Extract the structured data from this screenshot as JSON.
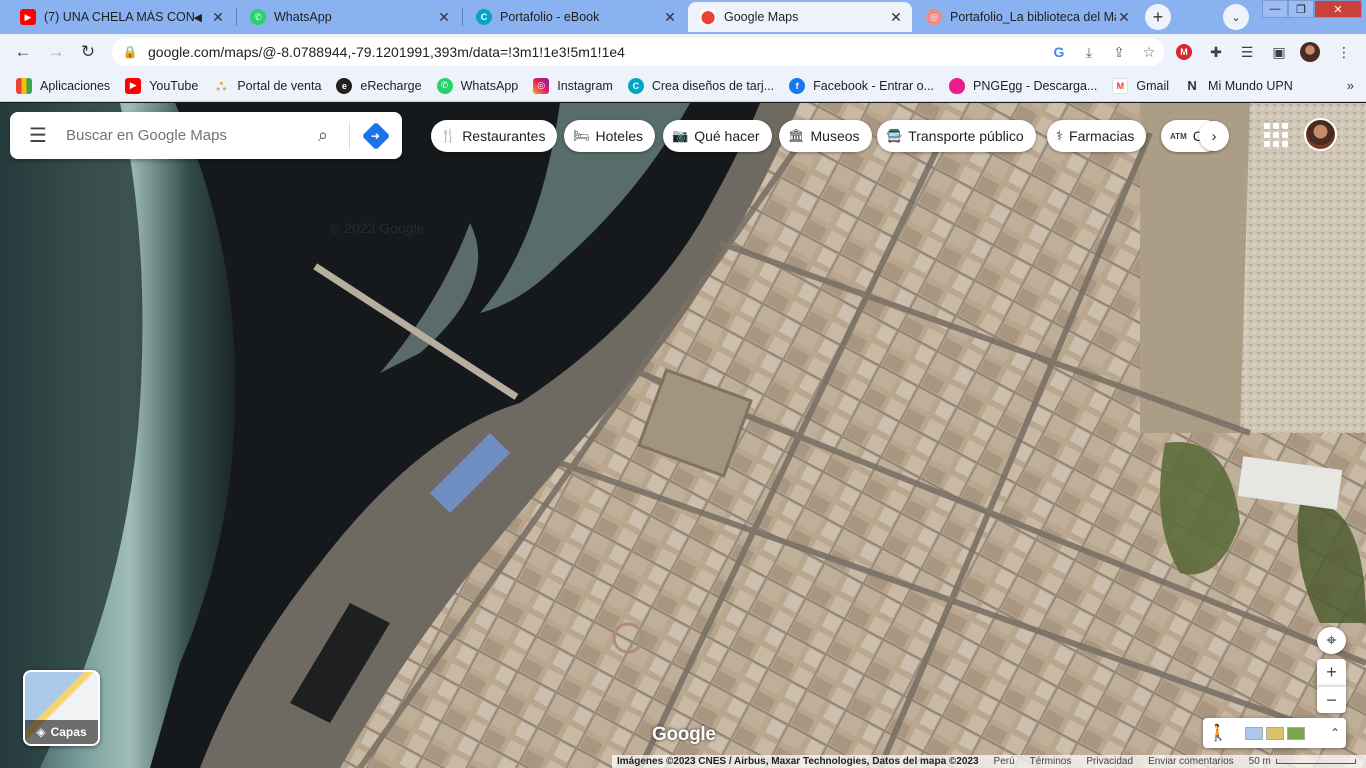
{
  "tabs": [
    {
      "title": "(7) UNA CHELA MÁS CON",
      "favicon": "youtube-icon",
      "muted_icon": "speaker-icon",
      "active": false
    },
    {
      "title": "WhatsApp",
      "favicon": "whatsapp-icon",
      "active": false
    },
    {
      "title": "Portafolio - eBook",
      "favicon": "canva-icon",
      "active": false
    },
    {
      "title": "Google Maps",
      "favicon": "google-maps-icon",
      "active": true
    },
    {
      "title": "Portafolio_La biblioteca del Ma",
      "favicon": "portfolio-icon",
      "active": false
    }
  ],
  "toolbar": {
    "url": "google.com/maps/@-8.0788944,-79.1201991,393m/data=!3m1!1e3!5m1!1e4"
  },
  "bookmarks": [
    {
      "label": "Aplicaciones",
      "icon": "apps-grid-icon"
    },
    {
      "label": "YouTube",
      "icon": "youtube-icon"
    },
    {
      "label": "Portal de venta",
      "icon": "portal-icon"
    },
    {
      "label": "eRecharge",
      "icon": "erecharge-icon"
    },
    {
      "label": "WhatsApp",
      "icon": "whatsapp-icon"
    },
    {
      "label": "Instagram",
      "icon": "instagram-icon"
    },
    {
      "label": "Crea diseños de tarj...",
      "icon": "canva-icon"
    },
    {
      "label": "Facebook - Entrar o...",
      "icon": "facebook-icon"
    },
    {
      "label": "PNGEgg - Descarga...",
      "icon": "pngegg-icon"
    },
    {
      "label": "Gmail",
      "icon": "gmail-icon"
    },
    {
      "label": "Mi Mundo UPN",
      "icon": "upn-icon"
    }
  ],
  "search": {
    "placeholder": "Buscar en Google Maps"
  },
  "chips": [
    {
      "label": "Restaurantes",
      "icon": "restaurant-icon"
    },
    {
      "label": "Hoteles",
      "icon": "hotel-icon"
    },
    {
      "label": "Qué hacer",
      "icon": "camera-icon"
    },
    {
      "label": "Museos",
      "icon": "museum-icon"
    },
    {
      "label": "Transporte público",
      "icon": "transit-icon"
    },
    {
      "label": "Farmacias",
      "icon": "pharmacy-icon"
    },
    {
      "label": "C",
      "icon": "atm-icon"
    }
  ],
  "layers": {
    "label": "Capas"
  },
  "attribution": {
    "imagery": "Imágenes ©2023 CNES / Airbus, Maxar Technologies, Datos del mapa ©2023",
    "country": "Perú",
    "terms": "Términos",
    "privacy": "Privacidad",
    "feedback": "Enviar comentarios",
    "scale": "50 m"
  },
  "logo": "Google",
  "colors": {
    "tab_strip": "#8ab1f0",
    "toolbar": "#eef2fb",
    "ocean": "#16191c",
    "surf": "#7fa7a2",
    "sand": "#6e6a62",
    "city": "#bba892",
    "directions_blue": "#1a73e8"
  }
}
